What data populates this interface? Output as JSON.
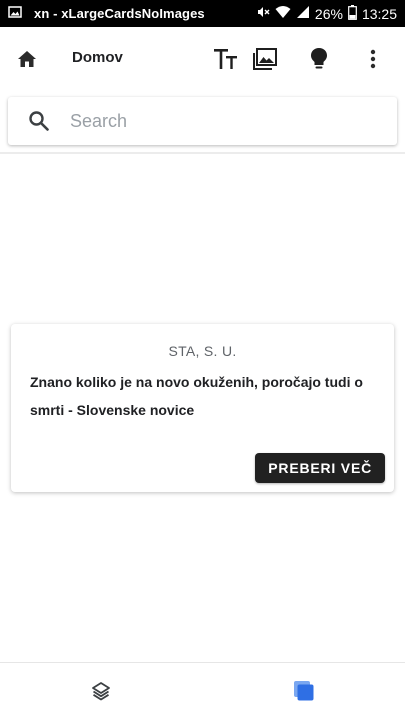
{
  "status_bar": {
    "title": "xn - xLargeCardsNoImages",
    "battery": "26%",
    "time": "13:25",
    "icons": [
      "image-icon",
      "mute-icon",
      "wifi-icon",
      "signal-icon",
      "battery-icon"
    ]
  },
  "app_bar": {
    "title": "Domov",
    "icons": [
      "home-icon",
      "text-size-icon",
      "images-icon",
      "lightbulb-icon",
      "more-vert-icon"
    ]
  },
  "search": {
    "placeholder": "Search",
    "value": ""
  },
  "article": {
    "source": "STA, S. U.",
    "headline": "Znano koliko je na novo okuženih, poročajo tudi o smrti - Slovenske novice",
    "button_label": "PREBERI VEČ"
  },
  "bottom_nav": {
    "items": [
      "layers-icon",
      "cards-icon"
    ],
    "active": "cards-icon"
  },
  "colors": {
    "accent": "#2f6fe4",
    "button_bg": "#212121",
    "status_bar_bg": "#000000"
  }
}
